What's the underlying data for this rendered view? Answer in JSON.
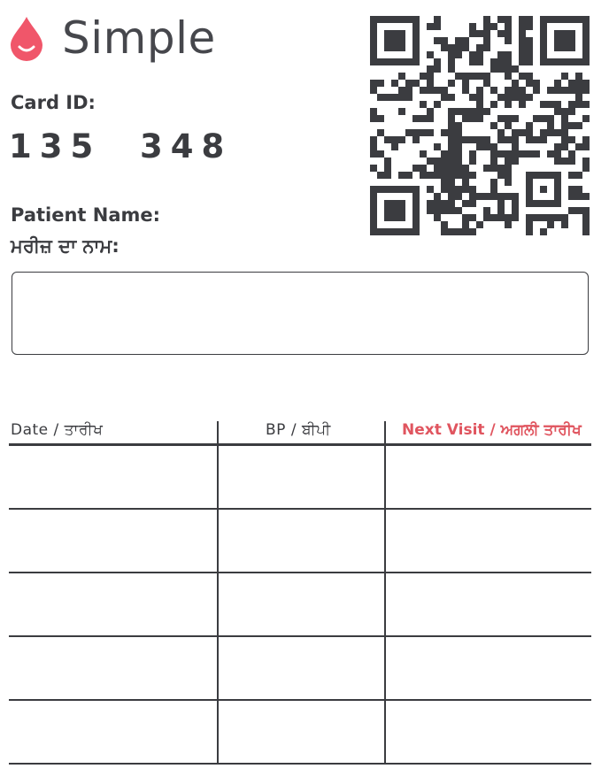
{
  "brand": {
    "name": "Simple",
    "icon": "blood-drop-icon",
    "accent_color": "#f0566a"
  },
  "card": {
    "id_label": "Card ID:",
    "id_value": "135  348"
  },
  "patient": {
    "name_label": "Patient Name:",
    "name_label_punjabi": "ਮਰੀਜ਼ ਦਾ ਨਾਮ:",
    "name_value": ""
  },
  "qr": {
    "icon": "qr-code-icon"
  },
  "table": {
    "headers": {
      "date": "Date / ਤਾਰੀਖ",
      "bp": "BP / ਬੀਪੀ",
      "next_visit": "Next Visit / ਅਗਲੀ ਤਾਰੀਖ"
    },
    "header_accent_color": "#e0555f",
    "rows": [
      {
        "date": "",
        "bp": "",
        "next_visit": ""
      },
      {
        "date": "",
        "bp": "",
        "next_visit": ""
      },
      {
        "date": "",
        "bp": "",
        "next_visit": ""
      },
      {
        "date": "",
        "bp": "",
        "next_visit": ""
      },
      {
        "date": "",
        "bp": "",
        "next_visit": ""
      }
    ]
  }
}
